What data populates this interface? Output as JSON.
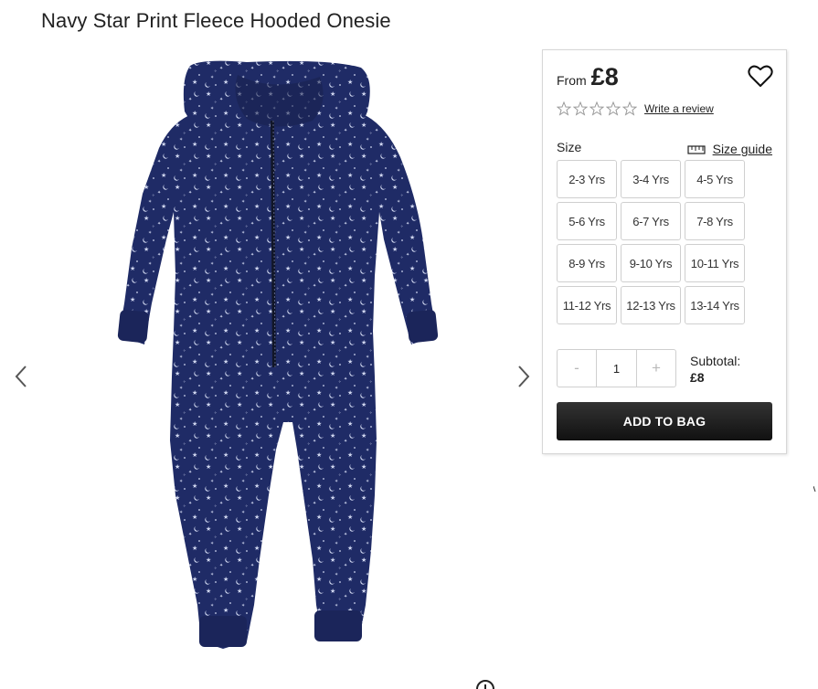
{
  "product": {
    "title": "Navy Star Print Fleece Hooded Onesie",
    "from_label": "From",
    "price": "£8",
    "write_review": "Write a review",
    "rating_stars": 0,
    "rating_max": 5
  },
  "size": {
    "label": "Size",
    "guide_label": "Size guide",
    "options": [
      "2-3 Yrs",
      "3-4 Yrs",
      "4-5 Yrs",
      "5-6 Yrs",
      "6-7 Yrs",
      "7-8 Yrs",
      "8-9 Yrs",
      "9-10 Yrs",
      "10-11 Yrs",
      "11-12 Yrs",
      "12-13 Yrs",
      "13-14 Yrs"
    ]
  },
  "quantity": {
    "minus": "-",
    "value": "1",
    "plus": "+"
  },
  "subtotal": {
    "label": "Subtotal:",
    "value": "£8"
  },
  "actions": {
    "add_to_bag": "ADD TO BAG"
  },
  "colors": {
    "garment_navy": "#1f2b66",
    "button_dark": "#222222"
  },
  "icons": {
    "prev": "chevron-left-icon",
    "next": "chevron-right-icon",
    "wishlist": "heart-icon",
    "size_guide": "ruler-icon",
    "zoom": "zoom-icon"
  }
}
